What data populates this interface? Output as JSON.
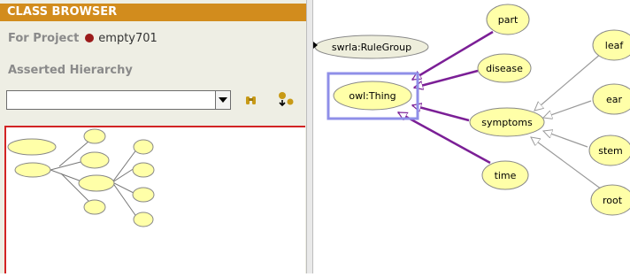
{
  "panel": {
    "title": "CLASS BROWSER",
    "project_label": "For Project",
    "project_name": "empty701",
    "hierarchy_label": "Asserted Hierarchy",
    "combo_value": ""
  },
  "graph": {
    "nodes": {
      "rulegroup": "swrla:RuleGroup",
      "thing": "owl:Thing",
      "part": "part",
      "disease": "disease",
      "symptoms": "symptoms",
      "time": "time",
      "leaf": "leaf",
      "ear": "ear",
      "stem": "stem",
      "root": "root"
    }
  },
  "colors": {
    "title_bar": "#d28c1d",
    "node_fill": "#ffffa8",
    "edge_purple": "#7b1f96",
    "edge_gray": "#9a9a9a",
    "selection": "#8f8fe8",
    "preview_border": "#d22424"
  },
  "icons": {
    "project": "project-hexagon-icon",
    "find": "binoculars-icon",
    "create_class": "create-class-icon",
    "combo_dropdown": "chevron-down-icon",
    "collapse": "collapse-triangle-icon"
  }
}
